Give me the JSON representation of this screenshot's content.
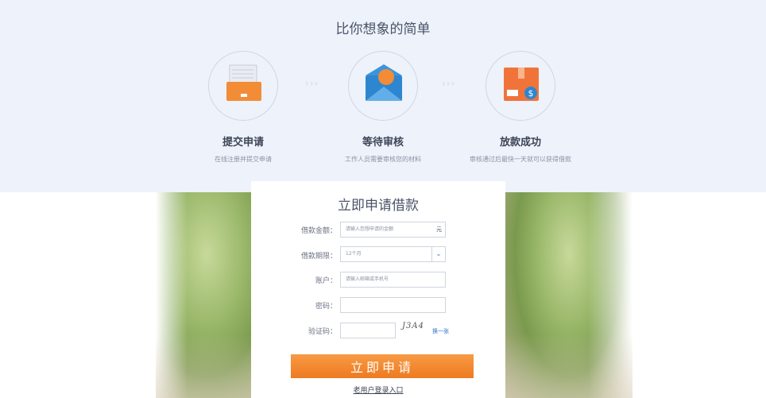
{
  "header": {
    "slogan": "比你想象的简单"
  },
  "steps": [
    {
      "title": "提交申请",
      "desc": "在线注册并提交申请",
      "icon": "drawer-icon"
    },
    {
      "title": "等待审核",
      "desc": "工作人员需要审核您的材料",
      "icon": "envelope-icon"
    },
    {
      "title": "放款成功",
      "desc": "审核通过后最快一天就可以获得借款",
      "icon": "money-box-icon"
    }
  ],
  "step_arrows": "›››",
  "form": {
    "title": "立即申请借款",
    "amount": {
      "label": "借款金额：",
      "placeholder": "请输入您想申请的金额",
      "unit": "元"
    },
    "term": {
      "label": "借款期限：",
      "value": "12个月",
      "arrow": "⌄"
    },
    "account": {
      "label": "账户：",
      "placeholder": "请输入邮箱或手机号"
    },
    "password": {
      "label": "密码：",
      "placeholder": ""
    },
    "captcha": {
      "label": "验证码：",
      "image_text": "J3A4",
      "refresh": "换一张"
    },
    "submit": "立即申请",
    "login_link": "老用户登录入口"
  },
  "colors": {
    "accent": "#ee7a20",
    "link": "#2a72c8",
    "band": "#eef2fb"
  }
}
